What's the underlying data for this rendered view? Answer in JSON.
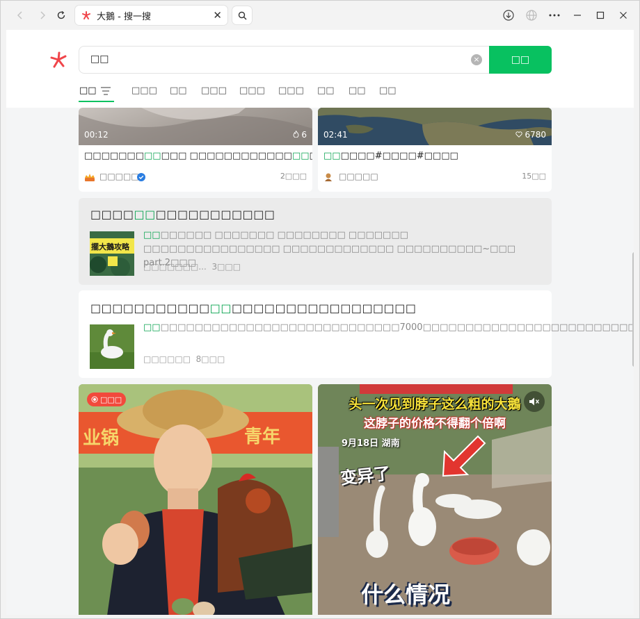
{
  "browser": {
    "tab_title": "大鵝 - 搜一搜",
    "tab_close": "✕"
  },
  "search": {
    "query": "□□",
    "clear": "×",
    "submit_label": "□□"
  },
  "filter_tabs": [
    {
      "label": "□□",
      "active": true
    },
    {
      "label": "□□□"
    },
    {
      "label": "□□"
    },
    {
      "label": "□□□"
    },
    {
      "label": "□□□"
    },
    {
      "label": "□□□"
    },
    {
      "label": "□□"
    },
    {
      "label": "□□"
    },
    {
      "label": "□□"
    }
  ],
  "video_cards": [
    {
      "duration": "00:12",
      "likes": "6",
      "title_pre": "□□□□□□□",
      "title_hl": "□□",
      "title_mid": "□□□ □□□□□□□□□□□□",
      "title_hl2": "□□",
      "title_post": "□□",
      "author": "□□□□□",
      "verified": true,
      "time": "2□□□"
    },
    {
      "duration": "02:41",
      "likes": "6780",
      "title_pre": "",
      "title_hl": "□□",
      "title_mid": "□□□□#□□□□#□□□□",
      "title_hl2": "",
      "title_post": "",
      "author": "□□□□□",
      "verified": false,
      "time": "15□□"
    }
  ],
  "articles": [
    {
      "title_pre": "□□□□",
      "title_hl": "□□",
      "title_post": "□□□□□□□□□□□",
      "snippet_hl": "□□",
      "snippet": "□□□□□□ □□□□□□□ □□□□□□□□ □□□□□□□ □□□□□□□□□□□□□□□□ □□□□□□□□□□□□□ □□□□□□□□□□~□□□ part.2□□□",
      "meta_source": "□□□□□□□...",
      "meta_time": "3□□□",
      "thumb_text": "擺大鵝攻略"
    },
    {
      "title_pre": "□□□□□□□□□□□",
      "title_hl": "□□",
      "title_post": "□□□□□□□□□□□□□□□□□",
      "snippet_hl": "□□",
      "snippet": "□□□□□□□□□□□□□□□□□□□□□□□□□□□□7000□□□□□□□□□□□□□□□□□□□□□□□□□□□□□□□□□□□□□□□□□□□□□",
      "meta_source": "□□□□□□",
      "meta_time": "8□□□"
    }
  ],
  "bottom_cards": [
    {
      "badge": "□□□"
    },
    {
      "overlay_line1": "头一次见到脖子这么粗的大鵝",
      "overlay_line2": "这脖子的价格不得翻个倍啊",
      "date_text": "9月18日 湖南",
      "sticker1": "变异了",
      "sticker2": "什么情况"
    }
  ],
  "colors": {
    "accent_green": "#08c160",
    "highlight_green": "#08a34f",
    "logo_red": "#f0454a"
  }
}
